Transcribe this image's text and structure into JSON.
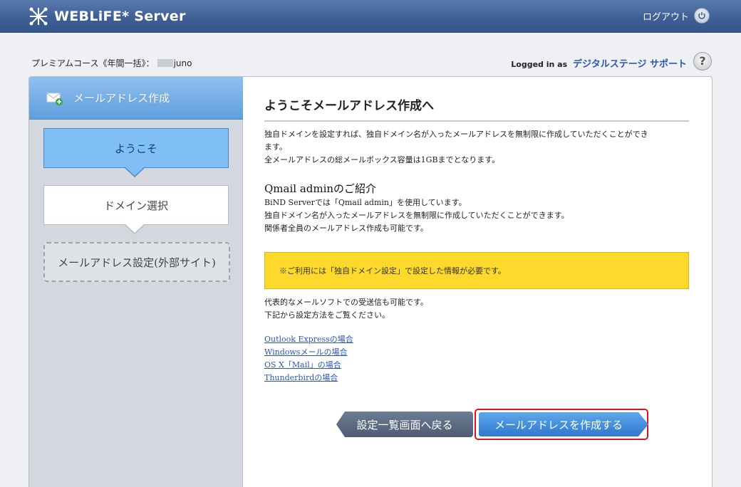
{
  "header": {
    "app_name": "WEBLiFE* Server",
    "logout_label": "ログアウト"
  },
  "subheader": {
    "course": "プレミアムコース《年間一括》：",
    "account": "juno",
    "logged_in_label": "Logged in as",
    "user_name": "デジタルステージ サポート",
    "help_label": "?"
  },
  "sidebar": {
    "title": "メールアドレス作成",
    "steps": [
      {
        "label": "ようこそ"
      },
      {
        "label": "ドメイン選択"
      },
      {
        "label": "メールアドレス設定(外部サイト)"
      }
    ]
  },
  "main": {
    "title": "ようこそメールアドレス作成へ",
    "intro_lines": [
      "独自ドメインを設定すれば、独自ドメイン名が入ったメールアドレスを無制限に作成していただくことができ",
      "ます。",
      "全メールアドレスの総メールボックス容量は1GBまでとなります。"
    ],
    "qmail_title": "Qmail adminのご紹介",
    "qmail_lines": [
      "BiND Serverでは「Qmail admin」を使用しています。",
      "独自ドメイン名が入ったメールアドレスを無制限に作成していただくことができます。",
      "関係者全員のメールアドレス作成も可能です。"
    ],
    "notice": "※ご利用には「独自ドメイン設定」で設定した情報が必要です。",
    "mail_soft_lines": [
      "代表的なメールソフトでの受送信も可能です。",
      "下記から設定方法をご覧ください。"
    ],
    "links": [
      "Outlook Expressの場合",
      "Windowsメールの場合",
      "OS X「Mail」の場合",
      "Thunderbirdの場合"
    ],
    "back_button": "設定一覧画面へ戻る",
    "create_button": "メールアドレスを作成する"
  },
  "colors": {
    "header_bg": "#3f5f95",
    "active_step": "#80bff5",
    "notice_bg": "#fdd92b",
    "create_btn": "#3f8ad8",
    "highlight": "#d6161d"
  }
}
